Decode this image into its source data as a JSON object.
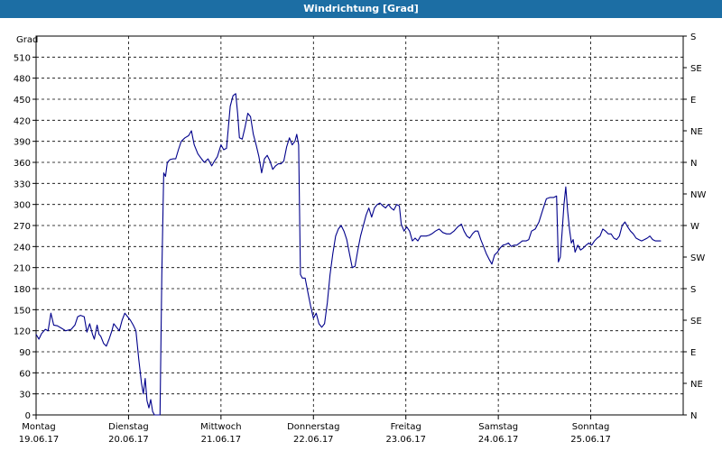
{
  "window": {
    "title": "Windrichtung [Grad]"
  },
  "chart_data": {
    "type": "line",
    "title": "Windrichtung [Grad]",
    "ylabel": "Grad",
    "ylim": [
      0,
      540
    ],
    "yticks": [
      0,
      30,
      60,
      90,
      120,
      150,
      180,
      210,
      240,
      270,
      300,
      330,
      360,
      390,
      420,
      450,
      480,
      510
    ],
    "y2ticks": [
      {
        "value": 0,
        "label": "N"
      },
      {
        "value": 45,
        "label": "NE"
      },
      {
        "value": 90,
        "label": "E"
      },
      {
        "value": 135,
        "label": "SE"
      },
      {
        "value": 180,
        "label": "S"
      },
      {
        "value": 225,
        "label": "SW"
      },
      {
        "value": 270,
        "label": "W"
      },
      {
        "value": 315,
        "label": "NW"
      },
      {
        "value": 360,
        "label": "N"
      },
      {
        "value": 405,
        "label": "NE"
      },
      {
        "value": 450,
        "label": "E"
      },
      {
        "value": 495,
        "label": "SE"
      },
      {
        "value": 540,
        "label": "S"
      }
    ],
    "xlim": [
      0,
      7
    ],
    "days": [
      {
        "day": "Montag",
        "date": "19.06.17"
      },
      {
        "day": "Dienstag",
        "date": "20.06.17"
      },
      {
        "day": "Mittwoch",
        "date": "21.06.17"
      },
      {
        "day": "Donnerstag",
        "date": "22.06.17"
      },
      {
        "day": "Freitag",
        "date": "23.06.17"
      },
      {
        "day": "Samstag",
        "date": "24.06.17"
      },
      {
        "day": "Sonntag",
        "date": "25.06.17"
      }
    ],
    "grid": true,
    "color": "#00008b",
    "series": [
      {
        "points": [
          [
            0.0,
            115
          ],
          [
            0.03,
            108
          ],
          [
            0.06,
            116
          ],
          [
            0.1,
            122
          ],
          [
            0.13,
            120
          ],
          [
            0.16,
            145
          ],
          [
            0.19,
            128
          ],
          [
            0.23,
            127
          ],
          [
            0.27,
            124
          ],
          [
            0.32,
            120
          ],
          [
            0.38,
            122
          ],
          [
            0.42,
            128
          ],
          [
            0.45,
            140
          ],
          [
            0.48,
            142
          ],
          [
            0.52,
            140
          ],
          [
            0.55,
            118
          ],
          [
            0.58,
            130
          ],
          [
            0.61,
            115
          ],
          [
            0.63,
            108
          ],
          [
            0.66,
            128
          ],
          [
            0.68,
            115
          ],
          [
            0.7,
            112
          ],
          [
            0.73,
            102
          ],
          [
            0.76,
            98
          ],
          [
            0.79,
            108
          ],
          [
            0.82,
            120
          ],
          [
            0.84,
            130
          ],
          [
            0.87,
            125
          ],
          [
            0.9,
            120
          ],
          [
            0.93,
            135
          ],
          [
            0.96,
            145
          ],
          [
            0.99,
            140
          ],
          [
            1.02,
            135
          ],
          [
            1.05,
            128
          ],
          [
            1.08,
            120
          ],
          [
            1.11,
            80
          ],
          [
            1.14,
            45
          ],
          [
            1.16,
            30
          ],
          [
            1.18,
            52
          ],
          [
            1.2,
            20
          ],
          [
            1.22,
            10
          ],
          [
            1.24,
            22
          ],
          [
            1.26,
            5
          ],
          [
            1.28,
            0
          ],
          [
            1.3,
            0
          ],
          [
            1.32,
            0
          ],
          [
            1.34,
            0
          ],
          [
            1.36,
            200
          ],
          [
            1.38,
            345
          ],
          [
            1.4,
            340
          ],
          [
            1.42,
            360
          ],
          [
            1.45,
            364
          ],
          [
            1.48,
            365
          ],
          [
            1.51,
            365
          ],
          [
            1.54,
            378
          ],
          [
            1.57,
            390
          ],
          [
            1.61,
            395
          ],
          [
            1.65,
            398
          ],
          [
            1.68,
            405
          ],
          [
            1.71,
            385
          ],
          [
            1.75,
            372
          ],
          [
            1.79,
            365
          ],
          [
            1.82,
            360
          ],
          [
            1.86,
            365
          ],
          [
            1.9,
            355
          ],
          [
            1.93,
            362
          ],
          [
            1.96,
            368
          ],
          [
            2.0,
            385
          ],
          [
            2.03,
            378
          ],
          [
            2.06,
            380
          ],
          [
            2.1,
            440
          ],
          [
            2.13,
            455
          ],
          [
            2.16,
            458
          ],
          [
            2.18,
            430
          ],
          [
            2.2,
            395
          ],
          [
            2.23,
            393
          ],
          [
            2.26,
            410
          ],
          [
            2.29,
            430
          ],
          [
            2.32,
            425
          ],
          [
            2.35,
            400
          ],
          [
            2.38,
            385
          ],
          [
            2.41,
            368
          ],
          [
            2.44,
            345
          ],
          [
            2.47,
            365
          ],
          [
            2.5,
            370
          ],
          [
            2.53,
            362
          ],
          [
            2.56,
            350
          ],
          [
            2.59,
            355
          ],
          [
            2.62,
            358
          ],
          [
            2.65,
            358
          ],
          [
            2.68,
            362
          ],
          [
            2.71,
            382
          ],
          [
            2.74,
            395
          ],
          [
            2.77,
            385
          ],
          [
            2.8,
            390
          ],
          [
            2.82,
            400
          ],
          [
            2.84,
            385
          ],
          [
            2.86,
            200
          ],
          [
            2.88,
            195
          ],
          [
            2.91,
            195
          ],
          [
            2.94,
            175
          ],
          [
            2.97,
            155
          ],
          [
            3.0,
            138
          ],
          [
            3.03,
            145
          ],
          [
            3.06,
            130
          ],
          [
            3.09,
            125
          ],
          [
            3.12,
            130
          ],
          [
            3.15,
            160
          ],
          [
            3.18,
            200
          ],
          [
            3.21,
            230
          ],
          [
            3.24,
            255
          ],
          [
            3.27,
            265
          ],
          [
            3.3,
            270
          ],
          [
            3.33,
            262
          ],
          [
            3.36,
            250
          ],
          [
            3.39,
            230
          ],
          [
            3.42,
            210
          ],
          [
            3.45,
            212
          ],
          [
            3.48,
            235
          ],
          [
            3.51,
            255
          ],
          [
            3.54,
            270
          ],
          [
            3.57,
            285
          ],
          [
            3.6,
            295
          ],
          [
            3.63,
            282
          ],
          [
            3.66,
            295
          ],
          [
            3.69,
            300
          ],
          [
            3.72,
            302
          ],
          [
            3.75,
            298
          ],
          [
            3.78,
            295
          ],
          [
            3.81,
            300
          ],
          [
            3.84,
            295
          ],
          [
            3.87,
            292
          ],
          [
            3.9,
            300
          ],
          [
            3.93,
            298
          ],
          [
            3.95,
            272
          ],
          [
            3.98,
            262
          ],
          [
            4.01,
            268
          ],
          [
            4.04,
            262
          ],
          [
            4.07,
            248
          ],
          [
            4.1,
            252
          ],
          [
            4.13,
            248
          ],
          [
            4.16,
            255
          ],
          [
            4.19,
            255
          ],
          [
            4.22,
            255
          ],
          [
            4.25,
            256
          ],
          [
            4.28,
            258
          ],
          [
            4.32,
            262
          ],
          [
            4.36,
            265
          ],
          [
            4.4,
            260
          ],
          [
            4.44,
            258
          ],
          [
            4.48,
            258
          ],
          [
            4.52,
            262
          ],
          [
            4.56,
            268
          ],
          [
            4.6,
            272
          ],
          [
            4.63,
            262
          ],
          [
            4.66,
            255
          ],
          [
            4.69,
            252
          ],
          [
            4.72,
            258
          ],
          [
            4.75,
            262
          ],
          [
            4.78,
            262
          ],
          [
            4.81,
            250
          ],
          [
            4.84,
            240
          ],
          [
            4.87,
            230
          ],
          [
            4.9,
            222
          ],
          [
            4.93,
            215
          ],
          [
            4.96,
            228
          ],
          [
            4.99,
            232
          ],
          [
            5.02,
            238
          ],
          [
            5.05,
            242
          ],
          [
            5.08,
            243
          ],
          [
            5.11,
            245
          ],
          [
            5.14,
            240
          ],
          [
            5.17,
            242
          ],
          [
            5.2,
            242
          ],
          [
            5.23,
            245
          ],
          [
            5.26,
            248
          ],
          [
            5.3,
            248
          ],
          [
            5.33,
            250
          ],
          [
            5.36,
            262
          ],
          [
            5.4,
            265
          ],
          [
            5.44,
            275
          ],
          [
            5.48,
            292
          ],
          [
            5.52,
            308
          ],
          [
            5.56,
            310
          ],
          [
            5.6,
            310
          ],
          [
            5.63,
            312
          ],
          [
            5.65,
            218
          ],
          [
            5.67,
            225
          ],
          [
            5.69,
            260
          ],
          [
            5.71,
            300
          ],
          [
            5.73,
            325
          ],
          [
            5.75,
            290
          ],
          [
            5.77,
            265
          ],
          [
            5.79,
            245
          ],
          [
            5.81,
            250
          ],
          [
            5.83,
            232
          ],
          [
            5.86,
            242
          ],
          [
            5.89,
            235
          ],
          [
            5.92,
            238
          ],
          [
            5.95,
            242
          ],
          [
            5.98,
            245
          ],
          [
            6.01,
            242
          ],
          [
            6.04,
            248
          ],
          [
            6.07,
            252
          ],
          [
            6.1,
            255
          ],
          [
            6.13,
            265
          ],
          [
            6.16,
            262
          ],
          [
            6.19,
            258
          ],
          [
            6.22,
            258
          ],
          [
            6.25,
            252
          ],
          [
            6.28,
            250
          ],
          [
            6.31,
            255
          ],
          [
            6.34,
            270
          ],
          [
            6.37,
            275
          ],
          [
            6.4,
            268
          ],
          [
            6.43,
            262
          ],
          [
            6.46,
            258
          ],
          [
            6.49,
            252
          ],
          [
            6.52,
            250
          ],
          [
            6.55,
            248
          ],
          [
            6.58,
            250
          ],
          [
            6.61,
            252
          ],
          [
            6.64,
            255
          ],
          [
            6.67,
            250
          ],
          [
            6.7,
            248
          ],
          [
            6.73,
            248
          ],
          [
            6.76,
            248
          ]
        ]
      }
    ]
  }
}
